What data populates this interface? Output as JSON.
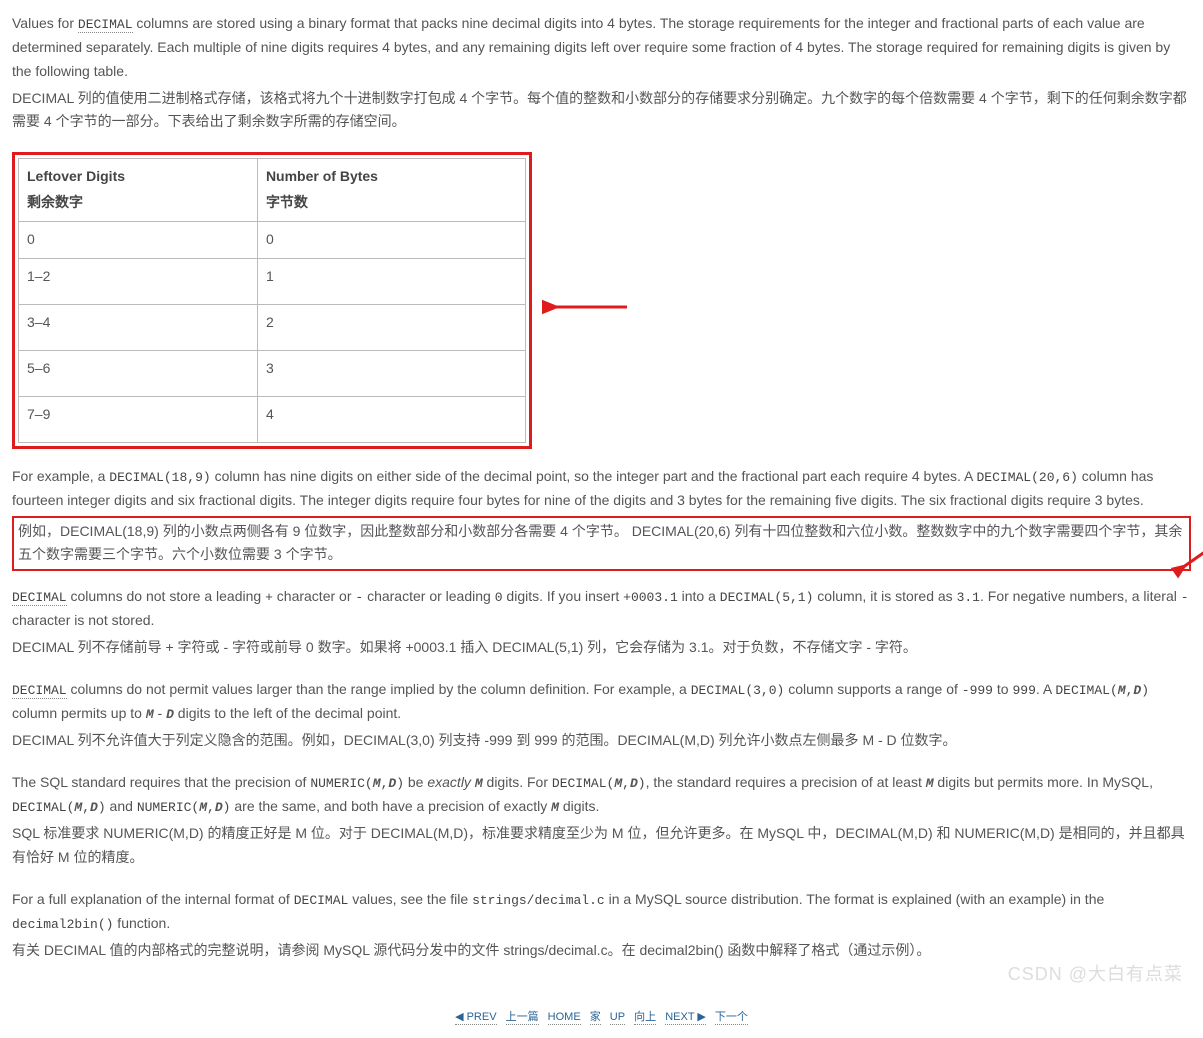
{
  "p1_en_pre": "Values for ",
  "p1_code_decimal": "DECIMAL",
  "p1_en_post": " columns are stored using a binary format that packs nine decimal digits into 4 bytes. The storage requirements for the integer and fractional parts of each value are determined separately. Each multiple of nine digits requires 4 bytes, and any remaining digits left over require some fraction of 4 bytes. The storage required for remaining digits is given by the following table.",
  "p1_zh": "DECIMAL 列的值使用二进制格式存储，该格式将九个十进制数字打包成 4 个字节。每个值的整数和小数部分的存储要求分别确定。九个数字的每个倍数需要 4 个字节，剩下的任何剩余数字都需要 4 个字节的一部分。下表给出了剩余数字所需的存储空间。",
  "table": {
    "h1_en": "Leftover Digits",
    "h1_zh": "剩余数字",
    "h2_en": "Number of Bytes",
    "h2_zh": "字节数",
    "rows": [
      {
        "a": "0",
        "b": "0"
      },
      {
        "a": "1–2",
        "b": "1"
      },
      {
        "a": "3–4",
        "b": "2"
      },
      {
        "a": "5–6",
        "b": "3"
      },
      {
        "a": "7–9",
        "b": "4"
      }
    ]
  },
  "p2_en_1": "For example, a ",
  "p2_code1": "DECIMAL(18,9)",
  "p2_en_2": " column has nine digits on either side of the decimal point, so the integer part and the fractional part each require 4 bytes. A ",
  "p2_code2": "DECIMAL(20,6)",
  "p2_en_3": " column has fourteen integer digits and six fractional digits. The integer digits require four bytes for nine of the digits and 3 bytes for the remaining five digits. The six fractional digits require 3 bytes.",
  "p2_zh": "例如，DECIMAL(18,9) 列的小数点两侧各有 9 位数字，因此整数部分和小数部分各需要 4 个字节。 DECIMAL(20,6) 列有十四位整数和六位小数。整数数字中的九个数字需要四个字节，其余五个数字需要三个字节。六个小数位需要 3 个字节。",
  "p3_code": "DECIMAL",
  "p3_en_1": " columns do not store a leading ",
  "p3_plus": "+",
  "p3_en_2": " character or ",
  "p3_minus": "-",
  "p3_en_3": " character or leading ",
  "p3_zero": "0",
  "p3_en_4": " digits. If you insert ",
  "p3_val1": "+0003.1",
  "p3_en_5": " into a ",
  "p3_dec51": "DECIMAL(5,1)",
  "p3_en_6": " column, it is stored as ",
  "p3_val2": "3.1",
  "p3_en_7": ". For negative numbers, a literal ",
  "p3_minus2": "-",
  "p3_en_8": " character is not stored.",
  "p3_zh": "DECIMAL 列不存储前导 + 字符或 - 字符或前导 0 数字。如果将 +0003.1 插入 DECIMAL(5,1) 列，它会存储为 3.1。对于负数，不存储文字 - 字符。",
  "p4_code": "DECIMAL",
  "p4_en_1": " columns do not permit values larger than the range implied by the column definition. For example, a ",
  "p4_dec30": "DECIMAL(3,0)",
  "p4_en_2": " column supports a range of ",
  "p4_neg999": "-999",
  "p4_en_3": " to ",
  "p4_pos999": "999",
  "p4_en_4": ". A ",
  "p4_decmd": "DECIMAL(",
  "p4_m": "M",
  "p4_comma": ",",
  "p4_d": "D",
  "p4_close": ")",
  "p4_en_5": " column permits up to ",
  "p4_m2": "M",
  "p4_dash": " - ",
  "p4_d2": "D",
  "p4_en_6": " digits to the left of the decimal point.",
  "p4_zh": "DECIMAL 列不允许值大于列定义隐含的范围。例如，DECIMAL(3,0) 列支持 -999 到 999 的范围。DECIMAL(M,D) 列允许小数点左侧最多 M - D 位数字。",
  "p5_en_1": "The SQL standard requires that the precision of ",
  "p5_num1": "NUMERIC(",
  "p5_en_2": " be ",
  "p5_exactly": "exactly",
  "p5_sp": " ",
  "p5_en_3": " digits. For ",
  "p5_dec2": "DECIMAL(",
  "p5_en_4": ", the standard requires a precision of at least ",
  "p5_en_5": " digits but permits more. In MySQL, ",
  "p5_en_6": " and ",
  "p5_en_7": " are the same, and both have a precision of exactly ",
  "p5_en_8": " digits.",
  "p5_zh": "SQL 标准要求 NUMERIC(M,D) 的精度正好是 M 位。对于 DECIMAL(M,D)，标准要求精度至少为 M 位，但允许更多。在 MySQL 中，DECIMAL(M,D) 和 NUMERIC(M,D) 是相同的，并且都具有恰好 M 位的精度。",
  "p6_en_1": "For a full explanation of the internal format of ",
  "p6_code1": "DECIMAL",
  "p6_en_2": " values, see the file ",
  "p6_file": "strings/decimal.c",
  "p6_en_3": " in a MySQL source distribution. The format is explained (with an example) in the ",
  "p6_func": "decimal2bin()",
  "p6_en_4": " function.",
  "p6_zh": "有关 DECIMAL 值的内部格式的完整说明，请参阅 MySQL 源代码分发中的文件 strings/decimal.c。在 decimal2bin() 函数中解释了格式（通过示例）。",
  "nav": {
    "prev_sym": "◀ PREV",
    "prev_zh": "上一篇",
    "home": "HOME",
    "home_zh": "家",
    "up": "UP",
    "up_zh": "向上",
    "next": "NEXT ▶",
    "next_zh": "下一个"
  },
  "watermark": "CSDN @大白有点菜"
}
